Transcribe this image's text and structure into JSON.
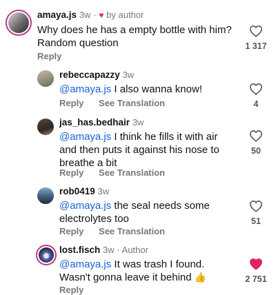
{
  "comments": [
    {
      "username": "amaya.js",
      "time": "3w",
      "heart_badge": "♥",
      "by_author": "by author",
      "text_line1": "Why does he has a empty bottle with him?",
      "text_line2": "Random question",
      "reply_label": "Reply",
      "like_count": "1 317",
      "liked": false
    },
    {
      "username": "rebeccapazzy",
      "time": "3w",
      "mention": "@amaya.js",
      "text": " I also wanna know!",
      "reply_label": "Reply",
      "translation_label": "See Translation",
      "like_count": "4",
      "liked": false
    },
    {
      "username": "jas_has.bedhair",
      "time": "3w",
      "mention": "@amaya.js",
      "text_line1": " I think he fills it with air",
      "text_line2": "and then puts it against his nose to",
      "text_line3": "breathe a bit",
      "reply_label": "Reply",
      "translation_label": "See Translation",
      "like_count": "50",
      "liked": false
    },
    {
      "username": "rob0419",
      "time": "3w",
      "mention": "@amaya.js",
      "text_line1": " the seal needs some",
      "text_line2": "electrolytes too",
      "reply_label": "Reply",
      "translation_label": "See Translation",
      "like_count": "51",
      "liked": false
    },
    {
      "username": "lost.fisch",
      "time": "3w",
      "author_badge": "· Author",
      "mention": "@amaya.js",
      "text_line1": "  It was trash I found.",
      "text_line2": "Wasn't gonna leave it behind",
      "emoji": "👍",
      "reply_label": "Reply",
      "like_count": "2 751",
      "liked": true
    }
  ],
  "colors": {
    "mention": "#1c5fd6",
    "liked_heart": "#e0245e",
    "muted_text": "#777777"
  },
  "icons": {
    "like": "heart-outline-icon",
    "liked": "heart-filled-icon"
  }
}
